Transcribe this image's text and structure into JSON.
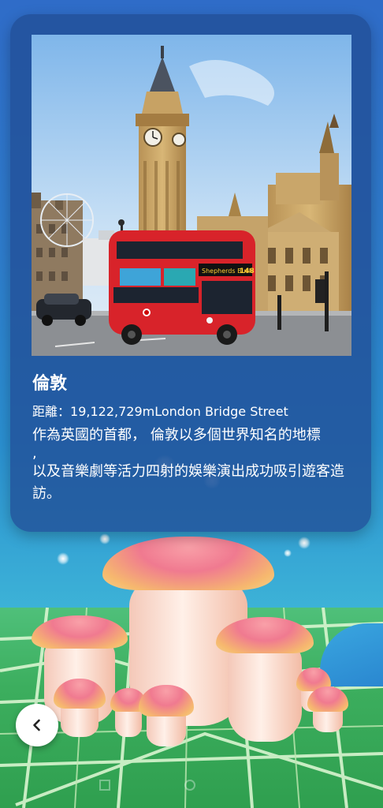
{
  "location": {
    "name": "倫敦",
    "distance_label": "距離：",
    "distance_value": "19,122,729m",
    "street": "London Bridge Street",
    "description_line1": "作為英國的首都， 倫敦以多個世界知名的地標",
    "description_line2": ",",
    "description_line3": "以及音樂劇等活力四射的娛樂演出成功吸引遊客造訪。"
  },
  "photo": {
    "bus_sign": "Shepherds Bush",
    "bus_route": "148"
  },
  "icons": {
    "back": "chevron-left-icon"
  },
  "colors": {
    "card_bg": "#214e96",
    "bus_red": "#d8232a",
    "sky": "#2f6cc8",
    "map_green": "#3cae5e"
  }
}
